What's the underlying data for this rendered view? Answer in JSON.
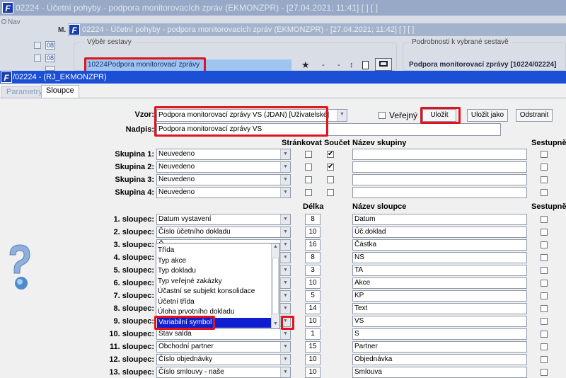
{
  "win1": {
    "title": "02224 - Účetní pohyby - podpora monitorovacích zpráv (EKMONZPR) - [27.04.2021; 11:41]  [ ]  [ ]",
    "nav": "Nav"
  },
  "win2": {
    "title": "02224 - Účetní pohyby - podpora monitorovacích zpráv (EKMONZPR) - [27.04.2021; 11:42]  [ ]  [ ]",
    "m_label": "M.",
    "row_num": "08"
  },
  "vyber": {
    "legend": "Výběr sestavy",
    "code": "10224",
    "name": "Podpora monitorovací zprávy"
  },
  "toolbar": {
    "star": "★",
    "dash1": "-",
    "dash2": "-",
    "updown": "↕"
  },
  "podrobnosti": {
    "legend": "Podrobnosti k vybrané sestavě",
    "value": "Podpora monitorovací zprávy [10224/02224]"
  },
  "dialog": {
    "title": "/02224 - (RJ_EKMONZPR)"
  },
  "tabs": {
    "parametry": "Parametry",
    "sloupce": "Sloupce"
  },
  "form": {
    "vzor_label": "Vzor:",
    "vzor_value": "Podpora monitorovací zprávy VS   (JDAN)  [Uživatelské]",
    "nadpis_label": "Nadpis:",
    "nadpis_value": "Podpora monitorovací zprávy VS",
    "verejny_label": "Veřejný",
    "ulozit": "Uložit",
    "ulozit_jako": "Uložit jako",
    "odstranit": "Odstranit"
  },
  "group_headers": {
    "strankovat": "Stránkovat",
    "soucet": "Součet",
    "nazev_skupiny": "Název skupiny",
    "sestupne": "Sestupně"
  },
  "groups": [
    {
      "label": "Skupina 1:",
      "value": "Neuvedeno",
      "strankovat": "",
      "soucet": ""
    },
    {
      "label": "Skupina 2:",
      "value": "Neuvedeno",
      "strankovat": "",
      "soucet": "✔"
    },
    {
      "label": "Skupina 3:",
      "value": "Neuvedeno",
      "strankovat": "",
      "soucet": ""
    },
    {
      "label": "Skupina 4:",
      "value": "Neuvedeno",
      "strankovat": "",
      "soucet": ""
    }
  ],
  "group1_soucet": "✔",
  "col_headers": {
    "delka": "Délka",
    "nazev_sloupce": "Název sloupce",
    "sestupne": "Sestupně"
  },
  "columns": [
    {
      "label": "1. sloupec:",
      "value": "Datum vystavení",
      "len": "8",
      "name": "Datum"
    },
    {
      "label": "2. sloupec:",
      "value": "Číslo účetního dokladu",
      "len": "10",
      "name": "Úč.doklad"
    },
    {
      "label": "3. sloupec:",
      "value": "Č...",
      "len": "16",
      "name": "Částka"
    },
    {
      "label": "4. sloupec:",
      "value": "",
      "len": "8",
      "name": "NS"
    },
    {
      "label": "5. sloupec:",
      "value": "",
      "len": "3",
      "name": "TA"
    },
    {
      "label": "6. sloupec:",
      "value": "",
      "len": "10",
      "name": "Akce"
    },
    {
      "label": "7. sloupec:",
      "value": "",
      "len": "5",
      "name": "KP"
    },
    {
      "label": "8. sloupec:",
      "value": "",
      "len": "14",
      "name": "Text"
    },
    {
      "label": "9. sloupec:",
      "value": "Variabilní symbol",
      "len": "10",
      "name": "VS"
    },
    {
      "label": "10. sloupec:",
      "value": "Stav salda",
      "len": "1",
      "name": "S"
    },
    {
      "label": "11. sloupec:",
      "value": "Obchodní partner",
      "len": "15",
      "name": "Partner"
    },
    {
      "label": "12. sloupec:",
      "value": "Číslo objednávky",
      "len": "10",
      "name": "Objednávka"
    },
    {
      "label": "13. sloupec:",
      "value": "Číslo smlouvy - naše",
      "len": "10",
      "name": "Smlouva"
    }
  ],
  "dropdown_items": [
    "Třída",
    "Typ akce",
    "Typ dokladu",
    "Typ veřejné zakázky",
    "Účastní se subjekt konsolidace",
    "Účetní třída",
    "Úloha prvotního dokladu",
    "Variabilní symbol"
  ],
  "colors": {
    "accent_red": "#e0141c",
    "dialog_title": "#1b4fd6",
    "selection": "#0f1fd0"
  }
}
